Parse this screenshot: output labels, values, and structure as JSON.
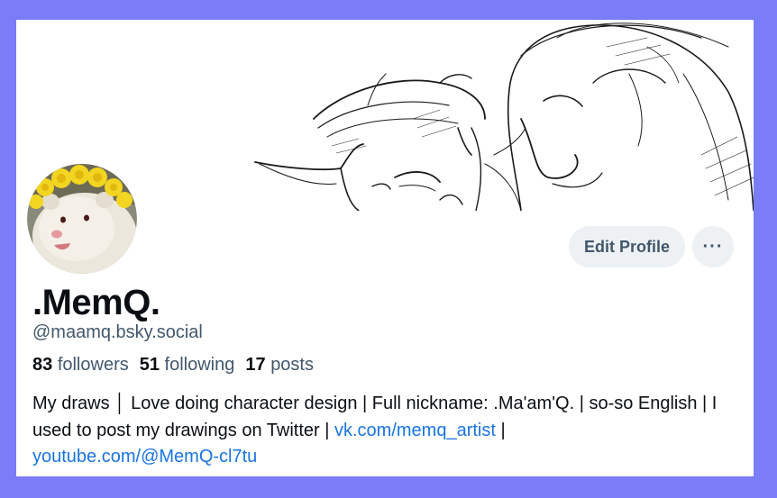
{
  "profile": {
    "display_name": ".MemQ.",
    "handle": "@maamq.bsky.social",
    "stats": {
      "followers_count": "83",
      "followers_label": "followers",
      "following_count": "51",
      "following_label": "following",
      "posts_count": "17",
      "posts_label": "posts"
    },
    "bio": {
      "text_1": "My draws │  Love doing character design | Full nickname: .Ma'am'Q. | so-so English | I used to post my drawings on Twitter | ",
      "link_1": "vk.com/memq_artist",
      "text_2": " |",
      "link_2": "youtube.com/@MemQ-cl7tu"
    }
  },
  "actions": {
    "edit_label": "Edit Profile",
    "more_label": "···"
  },
  "icons": {
    "banner": "sketch-banner-image",
    "avatar": "ferret-with-dandelion-crown"
  },
  "colors": {
    "page_background": "#7b7cf7",
    "link": "#1a75e0",
    "muted_text": "#42576c",
    "button_bg": "#eef1f4"
  }
}
